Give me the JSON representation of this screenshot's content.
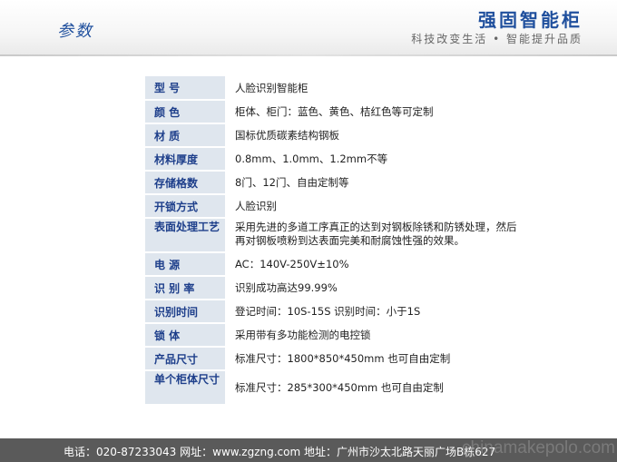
{
  "header": {
    "section_title": "参数",
    "brand_title": "强固智能柜",
    "brand_slogan": "科技改变生活 • 智能提升品质"
  },
  "specs": [
    {
      "label": "型    号",
      "value": "人脸识别智能柜"
    },
    {
      "label": "颜    色",
      "value": "柜体、柜门：蓝色、黄色、桔红色等可定制"
    },
    {
      "label": "材    质",
      "value": "国标优质碳素结构钢板"
    },
    {
      "label": "材料厚度",
      "value": "0.8mm、1.0mm、1.2mm不等"
    },
    {
      "label": "存储格数",
      "value": "8门、12门、自由定制等"
    },
    {
      "label": "开锁方式",
      "value": "人脸识别"
    },
    {
      "label": "表面处理工艺",
      "value": "采用先进的多道工序真正的达到对钢板除锈和防锈处理，然后再对钢板喷粉到达表面完美和耐腐蚀性强的效果。"
    },
    {
      "label": "电    源",
      "value": "AC：140V-250V±10%"
    },
    {
      "label": "识 别 率",
      "value": "识别成功高达99.99%"
    },
    {
      "label": "识别时间",
      "value": "登记时间：10S-15S  识别时间：小于1S"
    },
    {
      "label": "锁    体",
      "value": "采用带有多功能检测的电控锁"
    },
    {
      "label": "产品尺寸",
      "value": "标准尺寸：1800*850*450mm 也可自由定制"
    },
    {
      "label": "单个柜体尺寸",
      "value": "标准尺寸：285*300*450mm  也可自由定制"
    }
  ],
  "footer": {
    "text": "电话：020-87233043    网址：www.zgzng.com    地址：广州市沙太北路天丽广场B栋627"
  },
  "watermark": "chinamakepolo.com"
}
